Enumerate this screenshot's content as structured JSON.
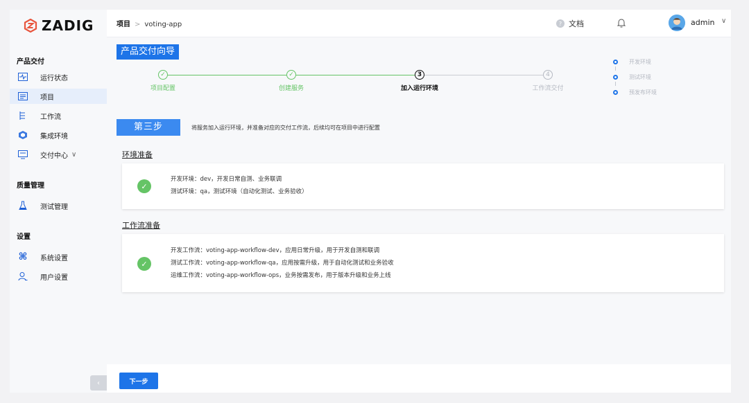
{
  "brand": {
    "logo_text": "ZADIG",
    "accent": "#1d74e8"
  },
  "sidebar": {
    "groups": [
      {
        "label": "产品交付"
      },
      {
        "label": "质量管理"
      },
      {
        "label": "设置"
      }
    ],
    "items": [
      {
        "label": "运行状态",
        "icon": "pulse-monitor-icon"
      },
      {
        "label": "项目",
        "icon": "project-list-icon"
      },
      {
        "label": "工作流",
        "icon": "workflow-tree-icon"
      },
      {
        "label": "集成环境",
        "icon": "cube-icon"
      },
      {
        "label": "交付中心",
        "icon": "delivery-monitor-icon",
        "chevron": "∨"
      },
      {
        "label": "测试管理",
        "icon": "flask-icon"
      },
      {
        "label": "系统设置",
        "icon": "command-icon"
      },
      {
        "label": "用户设置",
        "icon": "user-icon"
      }
    ],
    "collapse_glyph": "‹"
  },
  "header": {
    "breadcrumb_root": "项目",
    "breadcrumb_sep": ">",
    "breadcrumb_current": "voting-app",
    "docs_label": "文档",
    "docs_glyph": "?",
    "user_name": "admin",
    "user_chevron": "∨"
  },
  "wizard": {
    "title": "产品交付向导",
    "steps": [
      {
        "label": "项目配置",
        "state": "done"
      },
      {
        "label": "创建服务",
        "state": "done"
      },
      {
        "label": "加入运行环境",
        "state": "current",
        "number": "3"
      },
      {
        "label": "工作流交付",
        "state": "pending",
        "number": "4"
      }
    ],
    "side_steps": [
      "开发环境",
      "测试环境",
      "预发布环境"
    ],
    "step_tag": "第三步",
    "step_desc": "将服务加入运行环境，并准备对应的交付工作流，后续均可在项目中进行配置"
  },
  "sections": {
    "env": {
      "title": "环境准备",
      "lines": [
        "开发环境：dev，开发日常自测、业务联调",
        "测试环境：qa，测试环境（自动化测试、业务验收）"
      ]
    },
    "workflow": {
      "title": "工作流准备",
      "lines": [
        "开发工作流：voting-app-workflow-dev，应用日常升级，用于开发自测和联调",
        "测试工作流：voting-app-workflow-qa，应用按需升级，用于自动化测试和业务验收",
        "运维工作流：voting-app-workflow-ops，业务按需发布，用于版本升级和业务上线"
      ]
    }
  },
  "footer": {
    "next_label": "下一步"
  }
}
